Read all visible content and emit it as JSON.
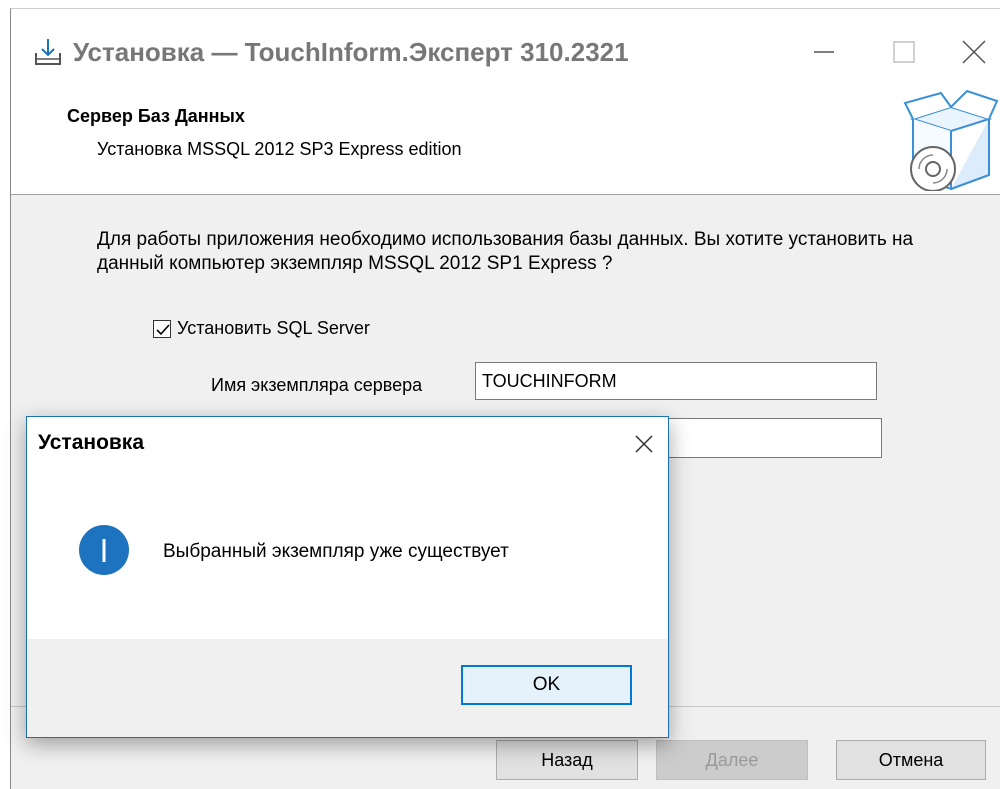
{
  "window": {
    "title": "Установка — TouchInform.Эксперт 310.2321"
  },
  "header": {
    "title": "Сервер Баз Данных",
    "subtitle": "Установка MSSQL 2012 SP3 Express edition"
  },
  "content": {
    "description": "Для работы приложения необходимо использования базы данных. Вы хотите установить на данный компьютер экземпляр MSSQL 2012 SP1 Express ?",
    "install_sql_checkbox": {
      "label": "Установить SQL Server",
      "checked": true
    },
    "instance_field": {
      "label": "Имя экземпляра сервера",
      "value": "TOUCHINFORM"
    },
    "second_field": {
      "value": ""
    }
  },
  "buttons": {
    "back": "Назад",
    "next": "Далее",
    "cancel": "Отмена"
  },
  "dialog": {
    "title": "Установка",
    "message": "Выбранный экземпляр уже существует",
    "ok": "OK",
    "icon": "info-icon"
  },
  "colors": {
    "accent": "#0078d7",
    "info_icon_blue": "#1e73be",
    "disabled_text": "#9a9a9a"
  }
}
